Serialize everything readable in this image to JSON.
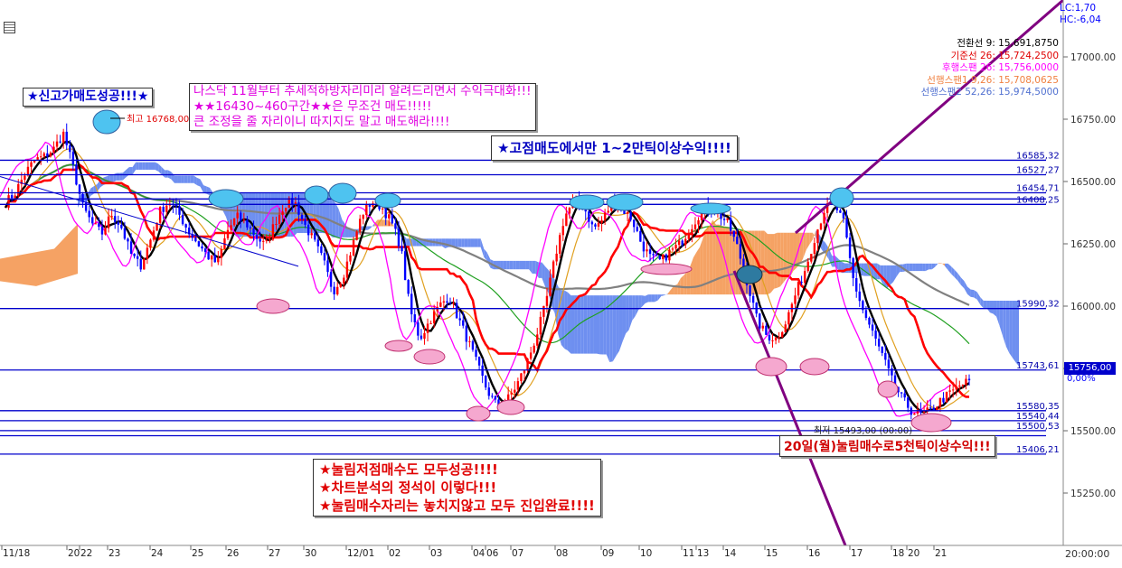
{
  "chart_data": {
    "type": "candlestick",
    "title": "",
    "y_axis_ticks": [
      "17000.00",
      "16750.00",
      "16500.00",
      "16250.00",
      "16000.00",
      "15750.00",
      "15500.00",
      "15250.00"
    ],
    "y_tick_values": [
      17000,
      16750,
      16500,
      16250,
      16000,
      15750,
      15500,
      15250
    ],
    "ylim": [
      15070,
      17220
    ],
    "x_axis_ticks": [
      "11/18",
      "20",
      "22",
      "23",
      "24",
      "25",
      "26",
      "27",
      "30",
      "12/01",
      "02",
      "03",
      "04",
      "06",
      "07",
      "08",
      "09",
      "10",
      "11",
      "13",
      "14",
      "15",
      "16",
      "17",
      "18",
      "20",
      "21"
    ],
    "time_axis_label": "20:00:00",
    "lc_hc": [
      "LC:1,70",
      "HC:-6,04"
    ],
    "legend": [
      {
        "label": "전환선 9: 15,691,8750",
        "color": "#000000"
      },
      {
        "label": "기준선 26: 15,724,2500",
        "color": "#e00000"
      },
      {
        "label": "후행스팬 26: 15,756,0000",
        "color": "#ff00ff"
      },
      {
        "label": "선행스팬1 9,26: 15,708,0625",
        "color": "#f08040"
      },
      {
        "label": "선행스팬2 52,26: 15,974,5000",
        "color": "#5070d0"
      }
    ],
    "horizontal_levels": [
      {
        "value": 16585.32,
        "label": "16585,32"
      },
      {
        "value": 16527.27,
        "label": "16527,27"
      },
      {
        "value": 16454.71,
        "label": "16454,71"
      },
      {
        "value": 16430,
        "label": ""
      },
      {
        "value": 16408.25,
        "label": "16408,25"
      },
      {
        "value": 15990.32,
        "label": "15990,32"
      },
      {
        "value": 15743.61,
        "label": "15743,61"
      },
      {
        "value": 15580.35,
        "label": "15580,35"
      },
      {
        "value": 15540.44,
        "label": "15540,44"
      },
      {
        "value": 15500.53,
        "label": "15500,53"
      },
      {
        "value": 15480,
        "label": ""
      },
      {
        "value": 15406.21,
        "label": "15406,21"
      }
    ],
    "current_price": {
      "value": 15756.0,
      "label": "15756,00",
      "change": "0,00%"
    },
    "high_marker": {
      "value": 16768.0,
      "label": "최고 16768,00 (00:00)"
    },
    "low_marker": {
      "value": 15493.0,
      "label": "최저 15493,00 (00:00)"
    },
    "close_approx": [
      16415,
      16455,
      16530,
      16585,
      16600,
      16630,
      16695,
      16560,
      16400,
      16330,
      16290,
      16370,
      16320,
      16210,
      16160,
      16260,
      16380,
      16420,
      16370,
      16300,
      16250,
      16200,
      16170,
      16300,
      16360,
      16330,
      16280,
      16240,
      16340,
      16410,
      16420,
      16330,
      16260,
      16180,
      16060,
      16120,
      16240,
      16370,
      16420,
      16400,
      16340,
      16240,
      15980,
      15870,
      15940,
      16000,
      16040,
      15950,
      15860,
      15760,
      15660,
      15600,
      15620,
      15680,
      15760,
      15870,
      16000,
      16190,
      16360,
      16420,
      16400,
      16310,
      16350,
      16420,
      16390,
      16350,
      16250,
      16190,
      16180,
      16220,
      16250,
      16310,
      16370,
      16400,
      16370,
      16330,
      16230,
      16090,
      15940,
      15880,
      15870,
      15940,
      16050,
      16150,
      16280,
      16390,
      16410,
      16330,
      16100,
      15980,
      15890,
      15800,
      15700,
      15630,
      15580,
      15565,
      15580,
      15620,
      15650,
      15680,
      15700
    ]
  },
  "annotations": {
    "new_high": "★신고가매도성공!!!★",
    "top_line1": "나스닥 11월부터 추세적하방자리미리 알려드리면서 수익극대화!!!",
    "top_line2": "★★16430~460구간★★은 무조건 매도!!!!!",
    "top_line3": "큰 조정을 줄 자리이니 따지지도 말고 매도해라!!!!",
    "mid": "★고점매도에서만 1~2만틱이상수익!!!!",
    "bottom_line1": "★눌림저점매수도 모두성공!!!!",
    "bottom_line2": "★차트분석의 정석이 이렇다!!!",
    "bottom_line3": "★눌림매수자리는 놓치지않고 모두 진입완료!!!!",
    "dip": "20일(월)눌림매수로5천틱이상수익!!!"
  },
  "colors": {
    "level_line": "#0000cc",
    "candle_up": "#ff0000",
    "candle_down": "#0000ff",
    "cloud_bull": "#f5a264",
    "cloud_bear": "#6e8ff0",
    "kijun": "#ff0000",
    "tenkan": "#000000",
    "chikou": "#ff00ff",
    "ma_long": "#808080",
    "ma_mid": "#20a020",
    "ma_short": "#e0a020",
    "trendline": "#800080",
    "marker_top": "#4ec3f0",
    "marker_bottom": "#f5a8cf"
  }
}
